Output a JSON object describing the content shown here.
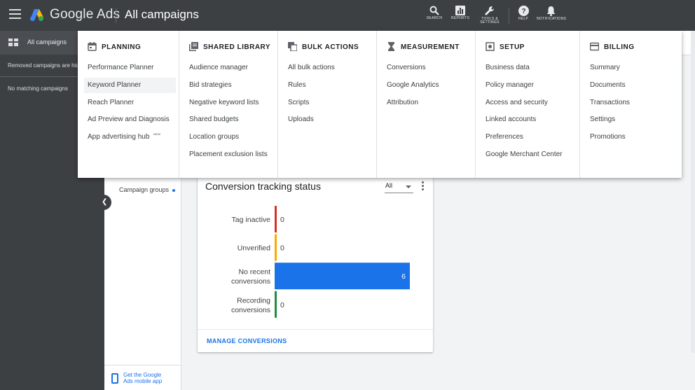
{
  "topbar": {
    "brand_google": "Google",
    "brand_ads": "Ads",
    "page_title": "All campaigns",
    "buttons": [
      {
        "label": "SEARCH",
        "icon": "search-icon"
      },
      {
        "label": "REPORTS",
        "icon": "reports-icon"
      },
      {
        "label": "TOOLS & SETTINGS",
        "label_l1": "TOOLS &",
        "label_l2": "SETTINGS",
        "icon": "wrench-icon"
      },
      {
        "label": "HELP",
        "icon": "help-icon"
      },
      {
        "label": "NOTIFICATIONS",
        "icon": "bell-icon"
      }
    ]
  },
  "leftnav": {
    "header": "All campaigns",
    "notice": "Removed campaigns are hid",
    "empty": "No matching campaigns"
  },
  "pagenav": {
    "item": "Campaign groups",
    "promo_line1": "Get the Google",
    "promo_line2": "Ads mobile app"
  },
  "card": {
    "title": "Conversion tracking status",
    "filter_value": "All",
    "footer_link": "MANAGE CONVERSIONS"
  },
  "chart_data": {
    "type": "bar",
    "orientation": "horizontal",
    "categories": [
      "Tag inactive",
      "Unverified",
      "No recent conversions",
      "Recording conversions"
    ],
    "category_lines": [
      [
        "Tag inactive"
      ],
      [
        "Unverified"
      ],
      [
        "No recent",
        "conversions"
      ],
      [
        "Recording",
        "conversions"
      ]
    ],
    "values": [
      0,
      0,
      6,
      0
    ],
    "value_labels": [
      "0",
      "0",
      "6",
      "0"
    ],
    "colors": [
      "#d93025",
      "#f9ab00",
      "#1a73e8",
      "#1e8e3e"
    ],
    "xlim": [
      0,
      6
    ]
  },
  "menu": {
    "columns": [
      {
        "title": "PLANNING",
        "icon": "calendar-icon",
        "items": [
          {
            "label": "Performance Planner"
          },
          {
            "label": "Keyword Planner",
            "selected": true
          },
          {
            "label": "Reach Planner"
          },
          {
            "label": "Ad Preview and Diagnosis"
          },
          {
            "label": "App advertising hub",
            "badge": "NEW"
          }
        ]
      },
      {
        "title": "SHARED LIBRARY",
        "icon": "library-icon",
        "items": [
          {
            "label": "Audience manager"
          },
          {
            "label": "Bid strategies"
          },
          {
            "label": "Negative keyword lists"
          },
          {
            "label": "Shared budgets"
          },
          {
            "label": "Location groups"
          },
          {
            "label": "Placement exclusion lists"
          }
        ]
      },
      {
        "title": "BULK ACTIONS",
        "icon": "bulk-actions-icon",
        "items": [
          {
            "label": "All bulk actions"
          },
          {
            "label": "Rules"
          },
          {
            "label": "Scripts"
          },
          {
            "label": "Uploads"
          }
        ]
      },
      {
        "title": "MEASUREMENT",
        "icon": "hourglass-icon",
        "items": [
          {
            "label": "Conversions"
          },
          {
            "label": "Google Analytics"
          },
          {
            "label": "Attribution"
          }
        ]
      },
      {
        "title": "SETUP",
        "icon": "setup-icon",
        "items": [
          {
            "label": "Business data"
          },
          {
            "label": "Policy manager"
          },
          {
            "label": "Access and security"
          },
          {
            "label": "Linked accounts"
          },
          {
            "label": "Preferences"
          },
          {
            "label": "Google Merchant Center"
          }
        ]
      },
      {
        "title": "BILLING",
        "icon": "credit-card-icon",
        "items": [
          {
            "label": "Summary"
          },
          {
            "label": "Documents"
          },
          {
            "label": "Transactions"
          },
          {
            "label": "Settings"
          },
          {
            "label": "Promotions"
          }
        ]
      }
    ]
  }
}
